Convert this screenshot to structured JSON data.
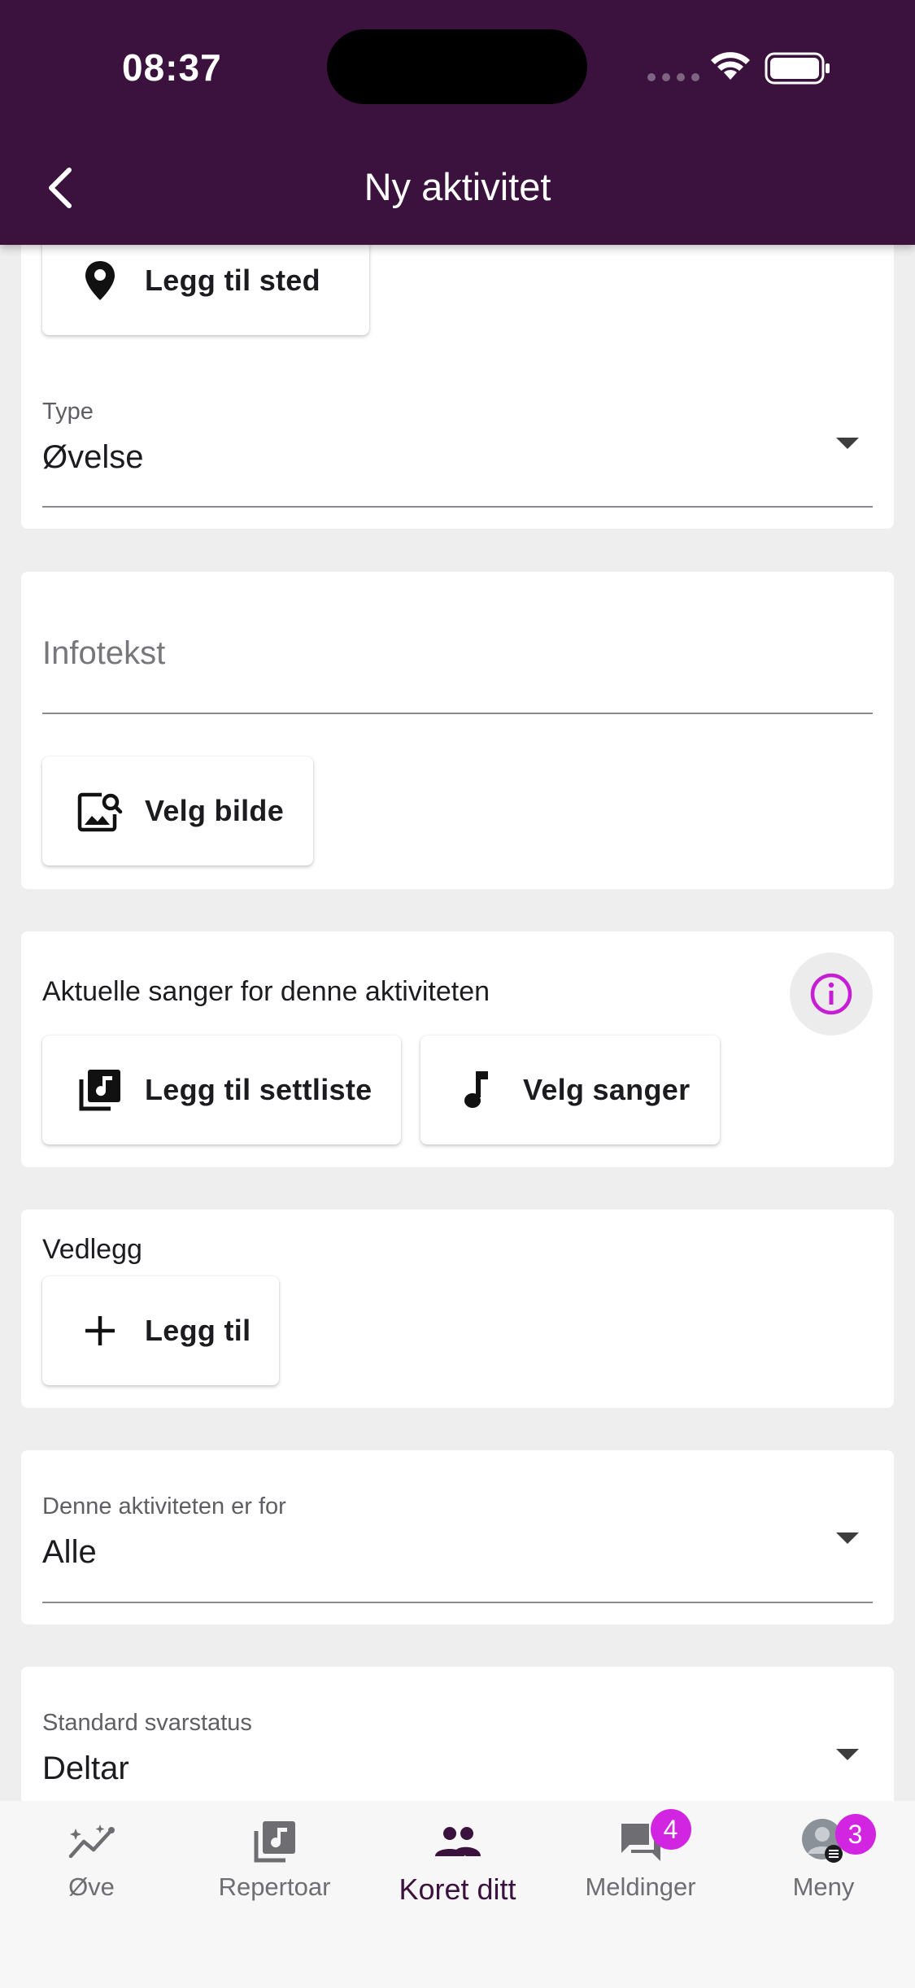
{
  "status_bar": {
    "time": "08:37"
  },
  "header": {
    "title": "Ny aktivitet",
    "back_icon": "chevron-left-icon"
  },
  "colors": {
    "brand": "#3a123d",
    "accent": "#d225e2",
    "background": "#efeeef"
  },
  "location_card": {
    "add_location_label": "Legg til sted",
    "type_label": "Type",
    "type_value": "Øvelse"
  },
  "info_card": {
    "info_placeholder": "Infotekst",
    "choose_image_label": "Velg bilde"
  },
  "songs_card": {
    "title": "Aktuelle sanger for denne aktiviteten",
    "add_setlist_label": "Legg til settliste",
    "choose_songs_label": "Velg sanger"
  },
  "attachments_card": {
    "title": "Vedlegg",
    "add_label": "Legg til"
  },
  "audience_card": {
    "label": "Denne aktiviteten er for",
    "value": "Alle"
  },
  "response_card": {
    "label": "Standard svarstatus",
    "value": "Deltar"
  },
  "bottom_nav": {
    "items": [
      {
        "label": "Øve",
        "icon": "practice-chart-icon"
      },
      {
        "label": "Repertoar",
        "icon": "music-library-icon"
      },
      {
        "label": "Koret ditt",
        "icon": "group-icon",
        "active": true
      },
      {
        "label": "Meldinger",
        "icon": "messages-icon",
        "badge": "4"
      },
      {
        "label": "Meny",
        "icon": "avatar-menu-icon",
        "badge": "3"
      }
    ]
  }
}
